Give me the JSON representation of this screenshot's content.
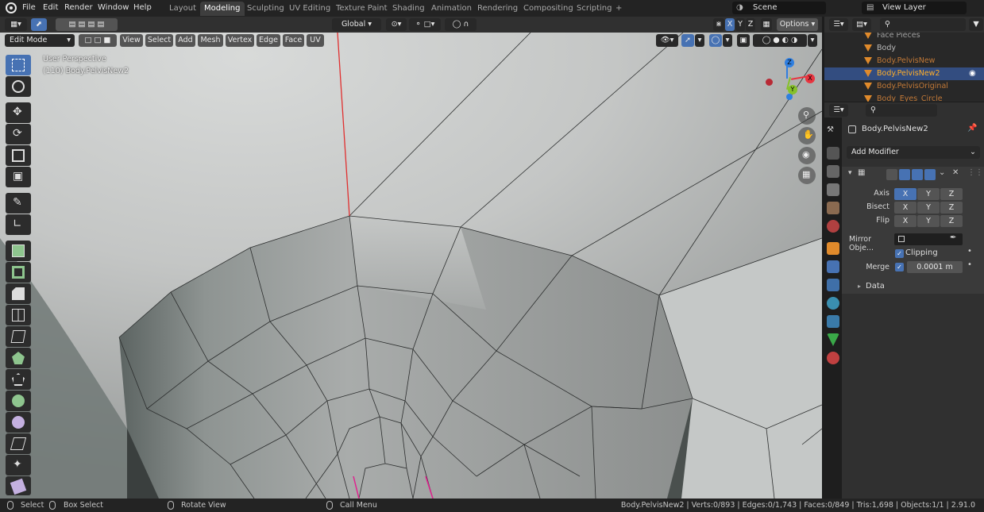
{
  "menus": [
    "File",
    "Edit",
    "Render",
    "Window",
    "Help"
  ],
  "workspaces": [
    "Layout",
    "Modeling",
    "Sculpting",
    "UV Editing",
    "Texture Paint",
    "Shading",
    "Animation",
    "Rendering",
    "Compositing",
    "Scripting",
    "+"
  ],
  "active_workspace": "Modeling",
  "scene": "Scene",
  "view_layer": "View Layer",
  "header": {
    "mode": "Edit Mode",
    "menus": [
      "View",
      "Select",
      "Add",
      "Mesh",
      "Vertex",
      "Edge",
      "Face",
      "UV"
    ],
    "orientation": "Global",
    "xyz": [
      "X",
      "Y",
      "Z"
    ],
    "options": "Options"
  },
  "viewport": {
    "perspective": "User Perspective",
    "object": "(110) Body.PelvisNew2",
    "gizmo": {
      "x": "X",
      "y": "Y",
      "z": "Z"
    }
  },
  "outliner": {
    "items": [
      "Face Pieces",
      "Body",
      "Body.PelvisNew",
      "Body.PelvisNew2",
      "Body.PelvisOriginal",
      "Body_Eyes_Circle"
    ],
    "selected_index": 3
  },
  "properties": {
    "object_name": "Body.PelvisNew2",
    "add_modifier": "Add Modifier",
    "axis_label": "Axis",
    "bisect_label": "Bisect",
    "flip_label": "Flip",
    "axes": [
      "X",
      "Y",
      "Z"
    ],
    "mirror_object_label": "Mirror Obje...",
    "clipping_label": "Clipping",
    "merge_label": "Merge",
    "merge_value": "0.0001 m",
    "data_label": "Data"
  },
  "status": {
    "select": "Select",
    "box_select": "Box Select",
    "rotate_view": "Rotate View",
    "call_menu": "Call Menu",
    "stats": "Body.PelvisNew2 | Verts:0/893 | Edges:0/1,743 | Faces:0/849 | Tris:1,698 | Objects:1/1 | 2.91.0"
  },
  "colors": {
    "accent": "#4772b3",
    "selected_object": "#ffaf29",
    "object": "#c07837",
    "panel": "#303030",
    "gizmo_x": "#e8343f",
    "gizmo_y": "#86c12b",
    "gizmo_z": "#2f7fe0"
  }
}
